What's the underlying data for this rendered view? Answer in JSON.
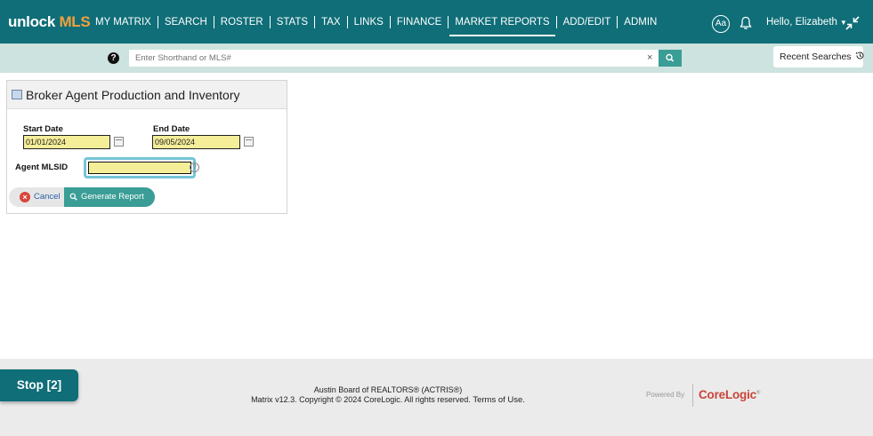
{
  "brand": {
    "logo_unlock": "unlock",
    "logo_mls": "MLS",
    "accent": "#0f6e78",
    "mls_color": "#f2a03d"
  },
  "nav": {
    "items": [
      {
        "label": "MY MATRIX"
      },
      {
        "label": "SEARCH"
      },
      {
        "label": "ROSTER"
      },
      {
        "label": "STATS"
      },
      {
        "label": "TAX"
      },
      {
        "label": "LINKS"
      },
      {
        "label": "FINANCE"
      },
      {
        "label": "MARKET REPORTS",
        "active": true
      },
      {
        "label": "ADD/EDIT"
      },
      {
        "label": "ADMIN"
      }
    ],
    "aa_label": "Aa",
    "user_greeting": "Hello, Elizabeth"
  },
  "search": {
    "help_icon": "question-icon",
    "placeholder": "Enter Shorthand or MLS#",
    "clear_label": "×",
    "recent_label": "Recent Searches"
  },
  "panel": {
    "title": "Broker Agent Production and Inventory",
    "start_date_label": "Start Date",
    "start_date_value": "01/01/2024",
    "end_date_label": "End Date",
    "end_date_value": "09/05/2024",
    "agent_mlsid_label": "Agent MLSID",
    "agent_mlsid_value": "",
    "help_label": "?",
    "cancel_label": "Cancel",
    "generate_label": "Generate Report"
  },
  "footer": {
    "line1": "Austin Board of REALTORS® (ACTRIS®)",
    "line2": "Matrix v12.3. Copyright © 2024 CoreLogic. All rights reserved.",
    "terms_label": "Terms of Use.",
    "powered_by": "Powered By",
    "corelogic": "CoreLogic"
  },
  "stop_button": {
    "label": "Stop [2]"
  }
}
